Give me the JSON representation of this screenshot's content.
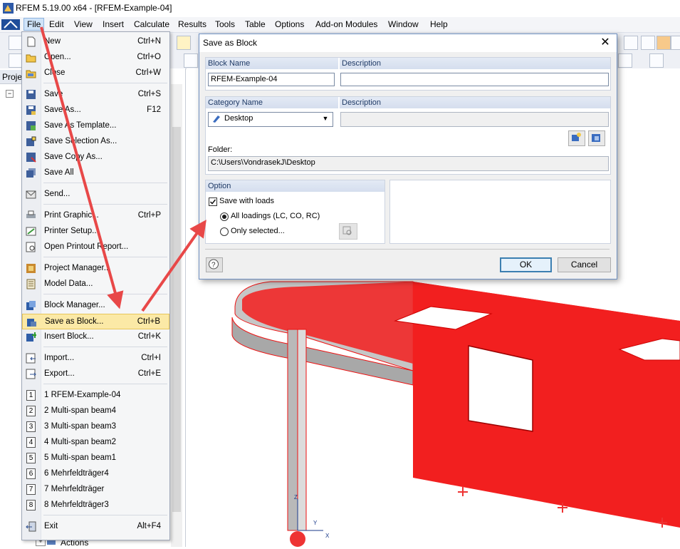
{
  "window": {
    "title": "RFEM 5.19.00 x64 - [RFEM-Example-04]"
  },
  "menubar": [
    "File",
    "Edit",
    "View",
    "Insert",
    "Calculate",
    "Results",
    "Tools",
    "Table",
    "Options",
    "Add-on Modules",
    "Window",
    "Help"
  ],
  "navigator": {
    "tab_label": "Proje",
    "tree_bottom_item": "Actions"
  },
  "file_menu": {
    "items": [
      {
        "label": "New",
        "shortcut": "Ctrl+N",
        "icon": "new-file-icon"
      },
      {
        "label": "Open...",
        "shortcut": "Ctrl+O",
        "icon": "open-folder-icon"
      },
      {
        "label": "Close",
        "shortcut": "Ctrl+W",
        "icon": "close-folder-icon"
      },
      {
        "label": "Save",
        "shortcut": "Ctrl+S",
        "icon": "save-icon"
      },
      {
        "label": "Save As...",
        "shortcut": "F12",
        "icon": "save-as-icon"
      },
      {
        "label": "Save As Template...",
        "shortcut": "",
        "icon": "save-template-icon"
      },
      {
        "label": "Save Selection As...",
        "shortcut": "",
        "icon": "save-selection-icon"
      },
      {
        "label": "Save Copy As...",
        "shortcut": "",
        "icon": "save-copy-icon"
      },
      {
        "label": "Save All",
        "shortcut": "",
        "icon": "save-all-icon"
      },
      {
        "label": "Send...",
        "shortcut": "",
        "icon": "send-icon"
      },
      {
        "label": "Print Graphic...",
        "shortcut": "Ctrl+P",
        "icon": "print-icon"
      },
      {
        "label": "Printer Setup...",
        "shortcut": "",
        "icon": "printer-setup-icon"
      },
      {
        "label": "Open Printout Report...",
        "shortcut": "",
        "icon": "printout-report-icon"
      },
      {
        "label": "Project Manager...",
        "shortcut": "",
        "icon": "project-manager-icon"
      },
      {
        "label": "Model Data...",
        "shortcut": "",
        "icon": "model-data-icon"
      },
      {
        "label": "Block Manager...",
        "shortcut": "",
        "icon": "block-manager-icon"
      },
      {
        "label": "Save as Block...",
        "shortcut": "Ctrl+B",
        "icon": "save-block-icon"
      },
      {
        "label": "Insert Block...",
        "shortcut": "Ctrl+K",
        "icon": "insert-block-icon"
      },
      {
        "label": "Import...",
        "shortcut": "Ctrl+I",
        "icon": "import-icon"
      },
      {
        "label": "Export...",
        "shortcut": "Ctrl+E",
        "icon": "export-icon"
      },
      {
        "label": "1 RFEM-Example-04",
        "shortcut": "",
        "icon": "recent-1-icon",
        "num": "1"
      },
      {
        "label": "2 Multi-span beam4",
        "shortcut": "",
        "icon": "recent-2-icon",
        "num": "2"
      },
      {
        "label": "3 Multi-span beam3",
        "shortcut": "",
        "icon": "recent-3-icon",
        "num": "3"
      },
      {
        "label": "4 Multi-span beam2",
        "shortcut": "",
        "icon": "recent-4-icon",
        "num": "4"
      },
      {
        "label": "5 Multi-span beam1",
        "shortcut": "",
        "icon": "recent-5-icon",
        "num": "5"
      },
      {
        "label": "6 Mehrfeldträger4",
        "shortcut": "",
        "icon": "recent-6-icon",
        "num": "6"
      },
      {
        "label": "7 Mehrfeldträger",
        "shortcut": "",
        "icon": "recent-7-icon",
        "num": "7"
      },
      {
        "label": "8 Mehrfeldträger3",
        "shortcut": "",
        "icon": "recent-8-icon",
        "num": "8"
      },
      {
        "label": "Exit",
        "shortcut": "Alt+F4",
        "icon": "exit-icon"
      }
    ],
    "highlighted": "Save as Block..."
  },
  "dialog": {
    "title": "Save as Block",
    "block_name_label": "Block Name",
    "block_name_value": "RFEM-Example-04",
    "description_label": "Description",
    "description_value": "",
    "category_label": "Category Name",
    "category_value": "Desktop",
    "category_description_label": "Description",
    "folder_label": "Folder:",
    "folder_value": "C:\\Users\\VondrasekJ\\Desktop",
    "option_label": "Option",
    "save_with_loads": "Save with loads",
    "all_loadings": "All loadings (LC, CO, RC)",
    "only_selected": "Only selected...",
    "ok": "OK",
    "cancel": "Cancel"
  },
  "colors": {
    "accent_red": "#ff1a1a",
    "menu_highlight": "#fbe9a6",
    "arrow_red": "#e84848"
  }
}
